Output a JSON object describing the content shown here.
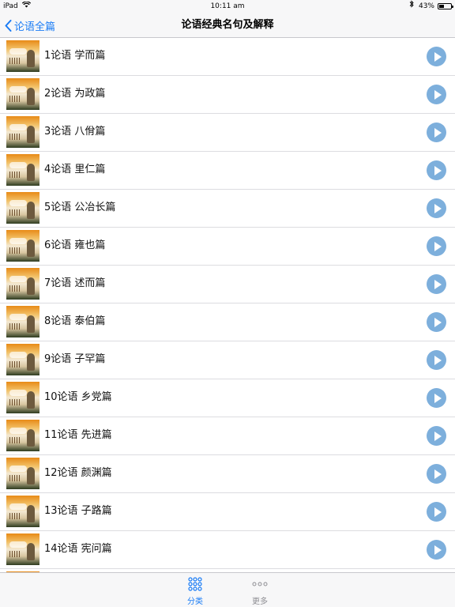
{
  "status_bar": {
    "device": "iPad",
    "time": "10:11 am",
    "battery_percent": "43%",
    "battery_level": 0.43
  },
  "nav": {
    "back_label": "论语全篇",
    "title": "论语经典名句及解释"
  },
  "list": {
    "items": [
      {
        "label": "1论语 学而篇"
      },
      {
        "label": "2论语 为政篇"
      },
      {
        "label": "3论语 八佾篇"
      },
      {
        "label": "4论语 里仁篇"
      },
      {
        "label": "5论语 公冶长篇"
      },
      {
        "label": "6论语 雍也篇"
      },
      {
        "label": "7论语 述而篇"
      },
      {
        "label": "8论语 泰伯篇"
      },
      {
        "label": "9论语 子罕篇"
      },
      {
        "label": "10论语 乡党篇"
      },
      {
        "label": "11论语 先进篇"
      },
      {
        "label": "12论语 颜渊篇"
      },
      {
        "label": "13论语 子路篇"
      },
      {
        "label": "14论语 宪问篇"
      }
    ]
  },
  "tabs": [
    {
      "label": "分类",
      "icon": "grid-icon",
      "active": true
    },
    {
      "label": "更多",
      "icon": "more-dots-icon",
      "active": false
    }
  ],
  "colors": {
    "accent": "#1a7cf5",
    "play_button": "#7dafdc",
    "inactive_tab": "#8e8e93"
  }
}
